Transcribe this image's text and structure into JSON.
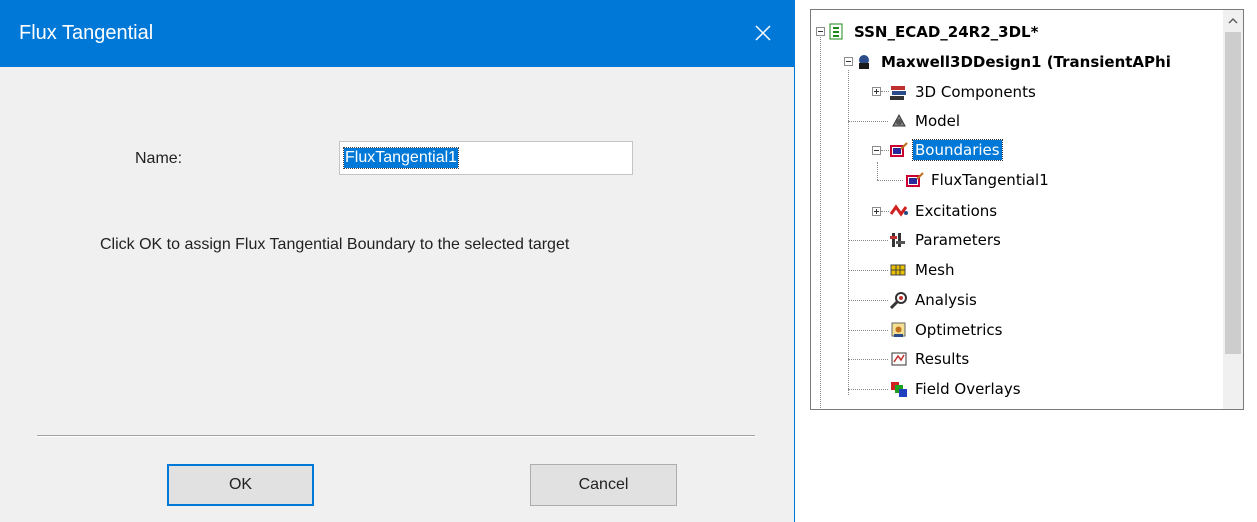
{
  "dialog": {
    "title": "Flux Tangential",
    "name_label": "Name:",
    "name_value": "FluxTangential1",
    "hint": "Click OK to assign Flux Tangential Boundary to the selected target",
    "ok_label": "OK",
    "cancel_label": "Cancel",
    "titlebar_color": "#0078d7"
  },
  "tree": {
    "project": "SSN_ECAD_24R2_3DL*",
    "design": "Maxwell3DDesign1 (TransientAPhi",
    "items": [
      {
        "label": "3D Components",
        "icon": "components-icon",
        "expandable": true
      },
      {
        "label": "Model",
        "icon": "model-icon",
        "expandable": false
      },
      {
        "label": "Boundaries",
        "icon": "boundaries-icon",
        "expandable": true,
        "selected": true
      },
      {
        "label": "FluxTangential1",
        "icon": "boundary-item-icon",
        "expandable": false,
        "child": true
      },
      {
        "label": "Excitations",
        "icon": "excitations-icon",
        "expandable": true
      },
      {
        "label": "Parameters",
        "icon": "parameters-icon",
        "expandable": false
      },
      {
        "label": "Mesh",
        "icon": "mesh-icon",
        "expandable": false
      },
      {
        "label": "Analysis",
        "icon": "analysis-icon",
        "expandable": false
      },
      {
        "label": "Optimetrics",
        "icon": "optimetrics-icon",
        "expandable": false
      },
      {
        "label": "Results",
        "icon": "results-icon",
        "expandable": false
      },
      {
        "label": "Field Overlays",
        "icon": "field-overlays-icon",
        "expandable": false
      }
    ]
  }
}
